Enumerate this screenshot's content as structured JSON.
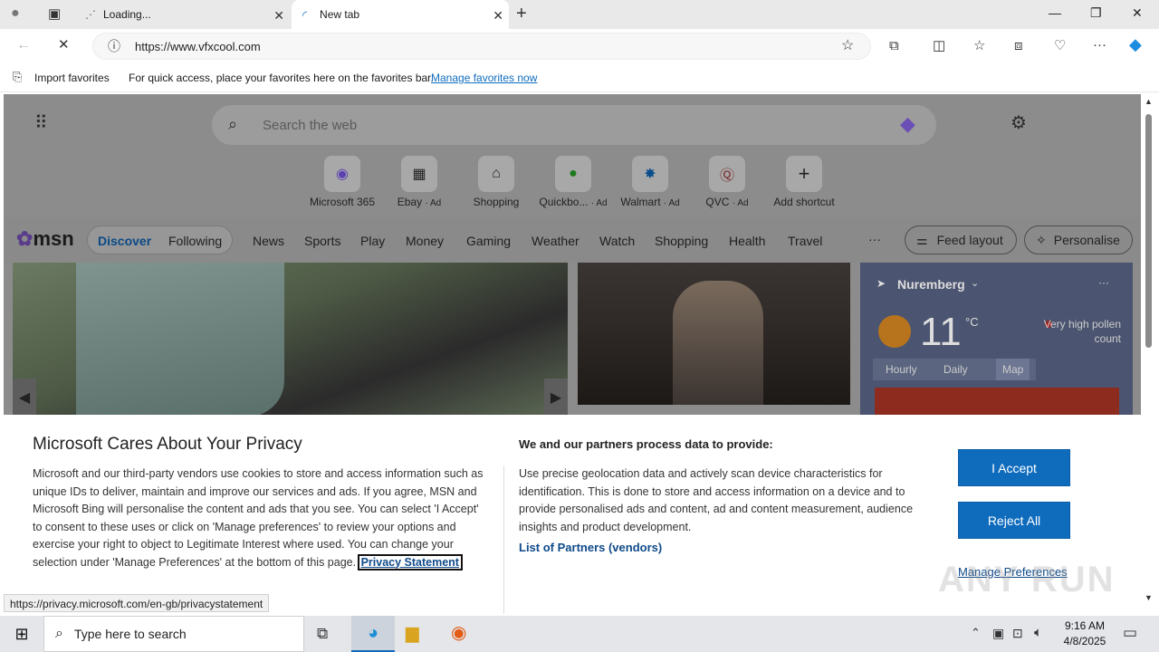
{
  "tabs": [
    {
      "title": "Loading...",
      "close": "✕"
    },
    {
      "title": "New tab",
      "close": "✕"
    }
  ],
  "new_tab": "+",
  "window": {
    "minimize": "—",
    "maximize": "❐",
    "close": "✕"
  },
  "address": {
    "url": "https://www.vfxcool.com"
  },
  "favorites": {
    "import": "Import favorites",
    "hint": "For quick access, place your favorites here on the favorites bar.",
    "link": "Manage favorites now"
  },
  "msn": {
    "search_placeholder": "Search the web",
    "shortcuts": [
      {
        "label": "Microsoft 365",
        "ad": ""
      },
      {
        "label": "Ebay",
        "ad": "· Ad"
      },
      {
        "label": "Shopping",
        "ad": ""
      },
      {
        "label": "Quickbo...",
        "ad": "· Ad"
      },
      {
        "label": "Walmart",
        "ad": "· Ad"
      },
      {
        "label": "QVC",
        "ad": "· Ad"
      },
      {
        "label": "Add shortcut",
        "ad": ""
      }
    ],
    "logo": "msn",
    "nav": [
      "Discover",
      "Following",
      "News",
      "Sports",
      "Play",
      "Money",
      "Gaming",
      "Weather",
      "Watch",
      "Shopping",
      "Health",
      "Travel"
    ],
    "more": "···",
    "feed_layout": "Feed layout",
    "personalise": "Personalise",
    "weather": {
      "location": "Nuremberg",
      "temp": "11",
      "unit": "°C",
      "pollen": "Very high pollen count",
      "tabs": [
        "Hourly",
        "Daily",
        "Map"
      ]
    }
  },
  "privacy": {
    "title": "Microsoft Cares About Your Privacy",
    "body": "Microsoft and our third-party vendors use cookies to store and access information such as unique IDs to deliver, maintain and improve our services and ads. If you agree, MSN and Microsoft Bing will personalise the content and ads that you see. You can select 'I Accept' to consent to these uses or click on 'Manage preferences' to review your options and exercise your right to object to Legitimate Interest where used.  You can change your selection under 'Manage Preferences' at the bottom of this page.",
    "statement_link": "Privacy Statement",
    "partners_title": "We and our partners process data to provide:",
    "partners_body": "Use precise geolocation data and actively scan device characteristics for identification. This is done to store and access information on a device and to provide personalised ads and content, ad and content measurement, audience insights and product development.",
    "partners_link": "List of Partners (vendors)",
    "accept": "I Accept",
    "reject": "Reject All",
    "manage": "Manage Preferences"
  },
  "status_url": "https://privacy.microsoft.com/en-gb/privacystatement",
  "taskbar": {
    "search": "Type here to search",
    "time": "9:16 AM",
    "date": "4/8/2025"
  },
  "watermark": "ANY RUN"
}
